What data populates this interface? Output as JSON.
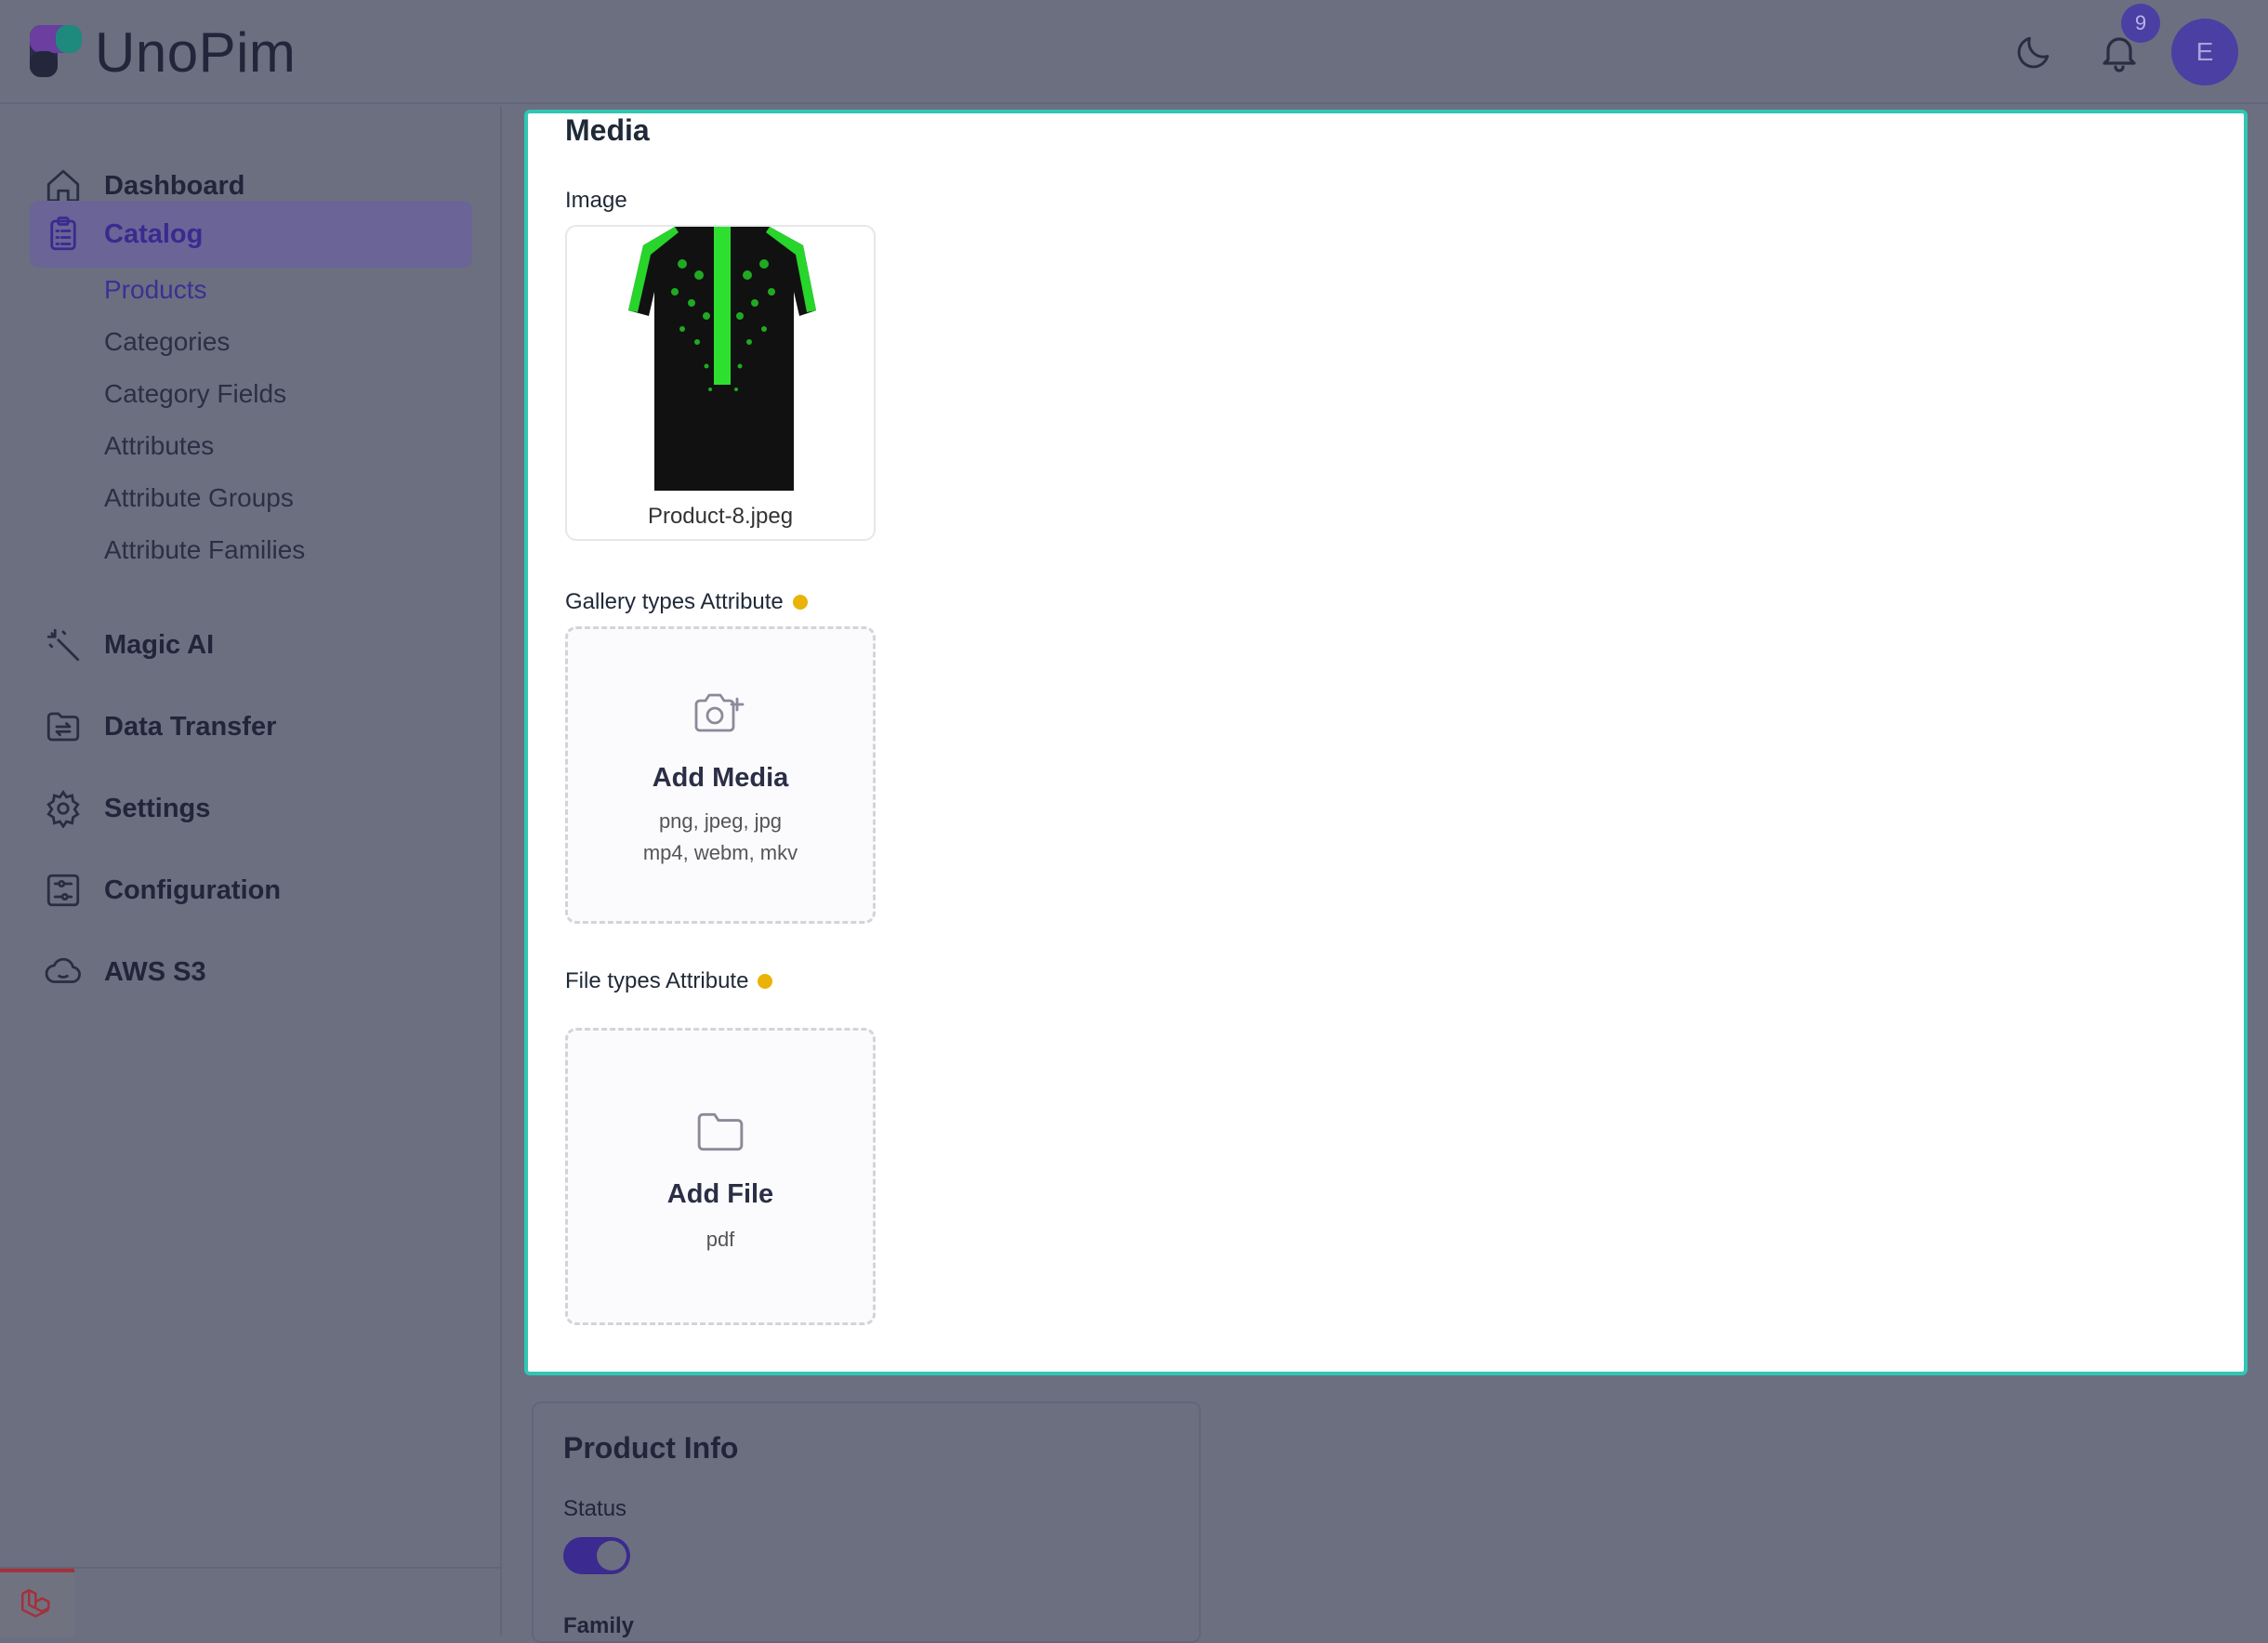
{
  "app": {
    "logo_text": "UnoPim",
    "notification_count": "9",
    "avatar_initial": "E"
  },
  "sidebar": {
    "items": [
      {
        "label": "Dashboard",
        "icon": "home-icon"
      },
      {
        "label": "Catalog",
        "icon": "clipboard-icon",
        "active": true
      },
      {
        "label": "Magic AI",
        "icon": "magic-wand-icon"
      },
      {
        "label": "Data Transfer",
        "icon": "folder-transfer-icon"
      },
      {
        "label": "Settings",
        "icon": "gear-icon"
      },
      {
        "label": "Configuration",
        "icon": "sliders-icon"
      },
      {
        "label": "AWS S3",
        "icon": "cloud-icon"
      }
    ],
    "catalog_sub": [
      "Products",
      "Categories",
      "Category Fields",
      "Attributes",
      "Attribute Groups",
      "Attribute Families"
    ],
    "active_sub": "Products"
  },
  "media": {
    "title": "Media",
    "image_label": "Image",
    "image_file": "Product-8.jpeg",
    "gallery_label": "Gallery types Attribute",
    "add_media": {
      "title": "Add Media",
      "types_line1": "png, jpeg, jpg",
      "types_line2": "mp4, webm, mkv"
    },
    "file_label": "File types Attribute",
    "add_file": {
      "title": "Add File",
      "types": "pdf"
    }
  },
  "product_info": {
    "title": "Product Info",
    "status_label": "Status",
    "status_on": true,
    "family_label": "Family"
  },
  "colors": {
    "accent": "#3b2a8f",
    "focus_border": "#2fc7b4",
    "required_dot": "#eab308",
    "laravel_red": "#a3313c"
  }
}
